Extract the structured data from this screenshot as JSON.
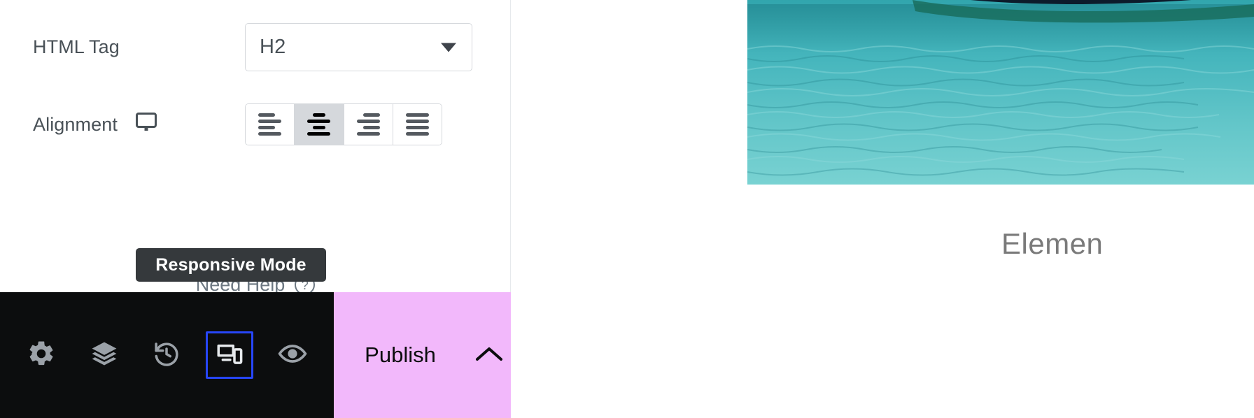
{
  "panel": {
    "controls": [
      {
        "label": "HTML Tag",
        "type": "select",
        "value": "H2",
        "icon": null
      },
      {
        "label": "Alignment",
        "type": "choices",
        "icon": "desktop-monitor-icon",
        "options": [
          {
            "name": "align-left",
            "label": "Align Left",
            "selected": false
          },
          {
            "name": "align-center",
            "label": "Align Center",
            "selected": true
          },
          {
            "name": "align-right",
            "label": "Align Right",
            "selected": false
          },
          {
            "name": "align-justify",
            "label": "Justify",
            "selected": false
          }
        ]
      }
    ],
    "need_help": {
      "label": "Need Help",
      "icon": "question-mark-circle-icon"
    }
  },
  "tooltip": {
    "text": "Responsive Mode"
  },
  "bottom_bar": {
    "tools": [
      {
        "name": "settings-icon",
        "label": "Settings",
        "focused": false
      },
      {
        "name": "navigator-layers-icon",
        "label": "Navigator",
        "focused": false
      },
      {
        "name": "history-revert-icon",
        "label": "History",
        "focused": false
      },
      {
        "name": "responsive-mode-icon",
        "label": "Responsive Mode",
        "focused": true
      },
      {
        "name": "preview-eye-icon",
        "label": "Preview Changes",
        "focused": false
      }
    ],
    "publish_label": "Publish",
    "publish_options_icon": "chevron-up-icon"
  },
  "preview": {
    "heading_text": "Elemen",
    "image_alt": "boat-on-turquoise-water"
  },
  "colors": {
    "panel_bg": "#ffffff",
    "label_text": "#495157",
    "border": "#d5d8dc",
    "active_segment": "#d5d8dc",
    "bottom_bar_bg": "#0c0d0e",
    "publish_bg": "#f2b8fb",
    "focus_outline": "#2746f8",
    "tooltip_bg": "#35393c",
    "heading_text": "#7a7a7a"
  }
}
